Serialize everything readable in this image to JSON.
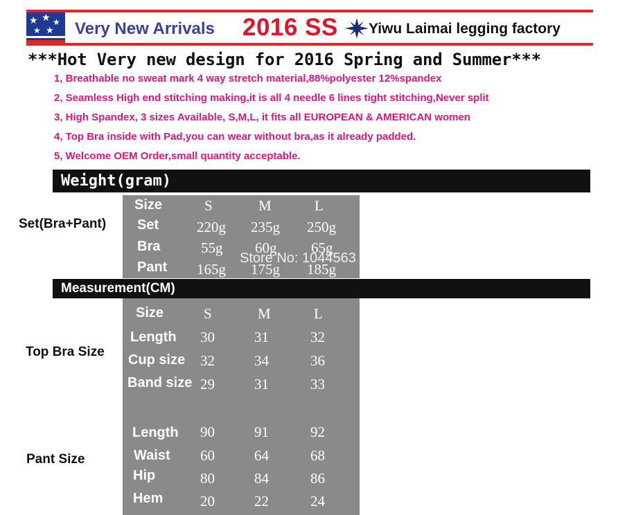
{
  "banner": {
    "arrivals": "Very New Arrivals",
    "season": "2016 SS",
    "factory": "Yiwu Laimai legging factory",
    "colors": {
      "stripe": "#e3232c",
      "flag_blue": "#1f3a93",
      "arrivals": "#3a3fa0",
      "season": "#e0142b"
    }
  },
  "headline": "***Hot Very new design for 2016 Spring and Summer***",
  "features": [
    "1,  Breathable no sweat mark 4 way stretch material,88%polyester 12%spandex",
    "2,  Seamless High end stitching making,it is all 4 needle 6 lines tight stitching,Never split",
    "3,  High Spandex, 3 sizes Available, S,M,L, it fits all EUROPEAN & AMERICAN women",
    "4,  Top Bra inside with Pad,you can wear without bra,as it already padded.",
    "5,  Welcome OEM Order,small quantity acceptable."
  ],
  "weight": {
    "title": "Weight(gram)",
    "side_label": "Set(Bra+Pant)",
    "header": {
      "label": "Size",
      "s": "S",
      "m": "M",
      "l": "L"
    },
    "rows": [
      {
        "label": "Set",
        "s": "220g",
        "m": "235g",
        "l": "250g"
      },
      {
        "label": "Bra",
        "s": "55g",
        "m": "60g",
        "l": "65g"
      },
      {
        "label": "Pant",
        "s": "165g",
        "m": "175g",
        "l": "185g"
      }
    ]
  },
  "watermark": "Store No: 1044563",
  "measurement": {
    "title": "Measurement(CM)",
    "top_label": "Top Bra Size",
    "pant_label": "Pant Size",
    "header": {
      "label": "Size",
      "s": "S",
      "m": "M",
      "l": "L"
    },
    "top_rows": [
      {
        "label": "Length",
        "s": "30",
        "m": "31",
        "l": "32"
      },
      {
        "label": "Cup size",
        "s": "32",
        "m": "34",
        "l": "36"
      },
      {
        "label": "Band size",
        "s": "29",
        "m": "31",
        "l": "33"
      }
    ],
    "pant_rows": [
      {
        "label": "Length",
        "s": "90",
        "m": "91",
        "l": "92"
      },
      {
        "label": "Waist",
        "s": "60",
        "m": "64",
        "l": "68"
      },
      {
        "label": "Hip",
        "s": "80",
        "m": "84",
        "l": "86"
      },
      {
        "label": "Hem",
        "s": "20",
        "m": "22",
        "l": "24"
      }
    ]
  }
}
